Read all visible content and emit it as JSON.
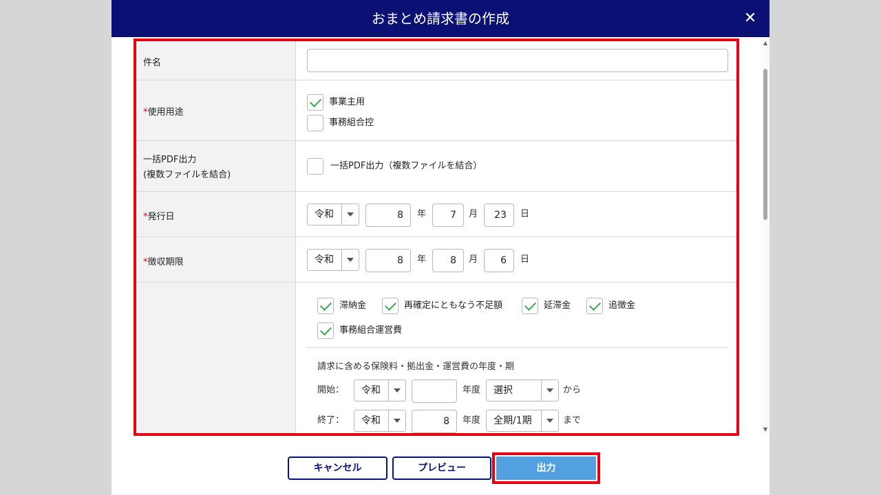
{
  "dialog": {
    "title": "おまとめ請求書の作成",
    "close": "✕"
  },
  "form": {
    "subject": {
      "label": "件名",
      "value": ""
    },
    "usage": {
      "required_mark": "*",
      "label": "使用用途",
      "options": [
        {
          "label": "事業主用",
          "checked": true
        },
        {
          "label": "事務組合控",
          "checked": false
        }
      ]
    },
    "bulk_pdf": {
      "label_line1": "一括PDF出力",
      "label_line2": "(複数ファイルを結合)",
      "option": {
        "label": "一括PDF出力（複数ファイルを結合）",
        "checked": false
      }
    },
    "issue_date": {
      "required_mark": "*",
      "label": "発行日",
      "era": "令和",
      "year": "8",
      "year_unit": "年",
      "month": "7",
      "month_unit": "月",
      "day": "23",
      "day_unit": "日"
    },
    "deadline": {
      "required_mark": "*",
      "label": "徴収期限",
      "era": "令和",
      "year": "8",
      "year_unit": "年",
      "month": "8",
      "month_unit": "月",
      "day": "6",
      "day_unit": "日"
    },
    "items": {
      "options": [
        {
          "label": "滞納金",
          "checked": true
        },
        {
          "label": "再確定にともなう不足額",
          "checked": true
        },
        {
          "label": "延滞金",
          "checked": true
        },
        {
          "label": "追徴金",
          "checked": true
        },
        {
          "label": "事務組合運営費",
          "checked": true
        }
      ],
      "period_note": "請求に含める保険料・拠出金・運営費の年度・期",
      "start": {
        "label": "開始：",
        "era": "令和",
        "year": "",
        "year_unit": "年度",
        "period": "選択",
        "suffix": "から"
      },
      "end": {
        "label": "終了：",
        "era": "令和",
        "year": "8",
        "year_unit": "年度",
        "period": "全期/1期",
        "suffix": "まで"
      }
    }
  },
  "footer": {
    "cancel": "キャンセル",
    "preview": "プレビュー",
    "output": "出力"
  },
  "colors": {
    "header": "#0b1174",
    "highlight": "#e60012",
    "primary": "#52a0e0",
    "check": "#3aa64a"
  }
}
